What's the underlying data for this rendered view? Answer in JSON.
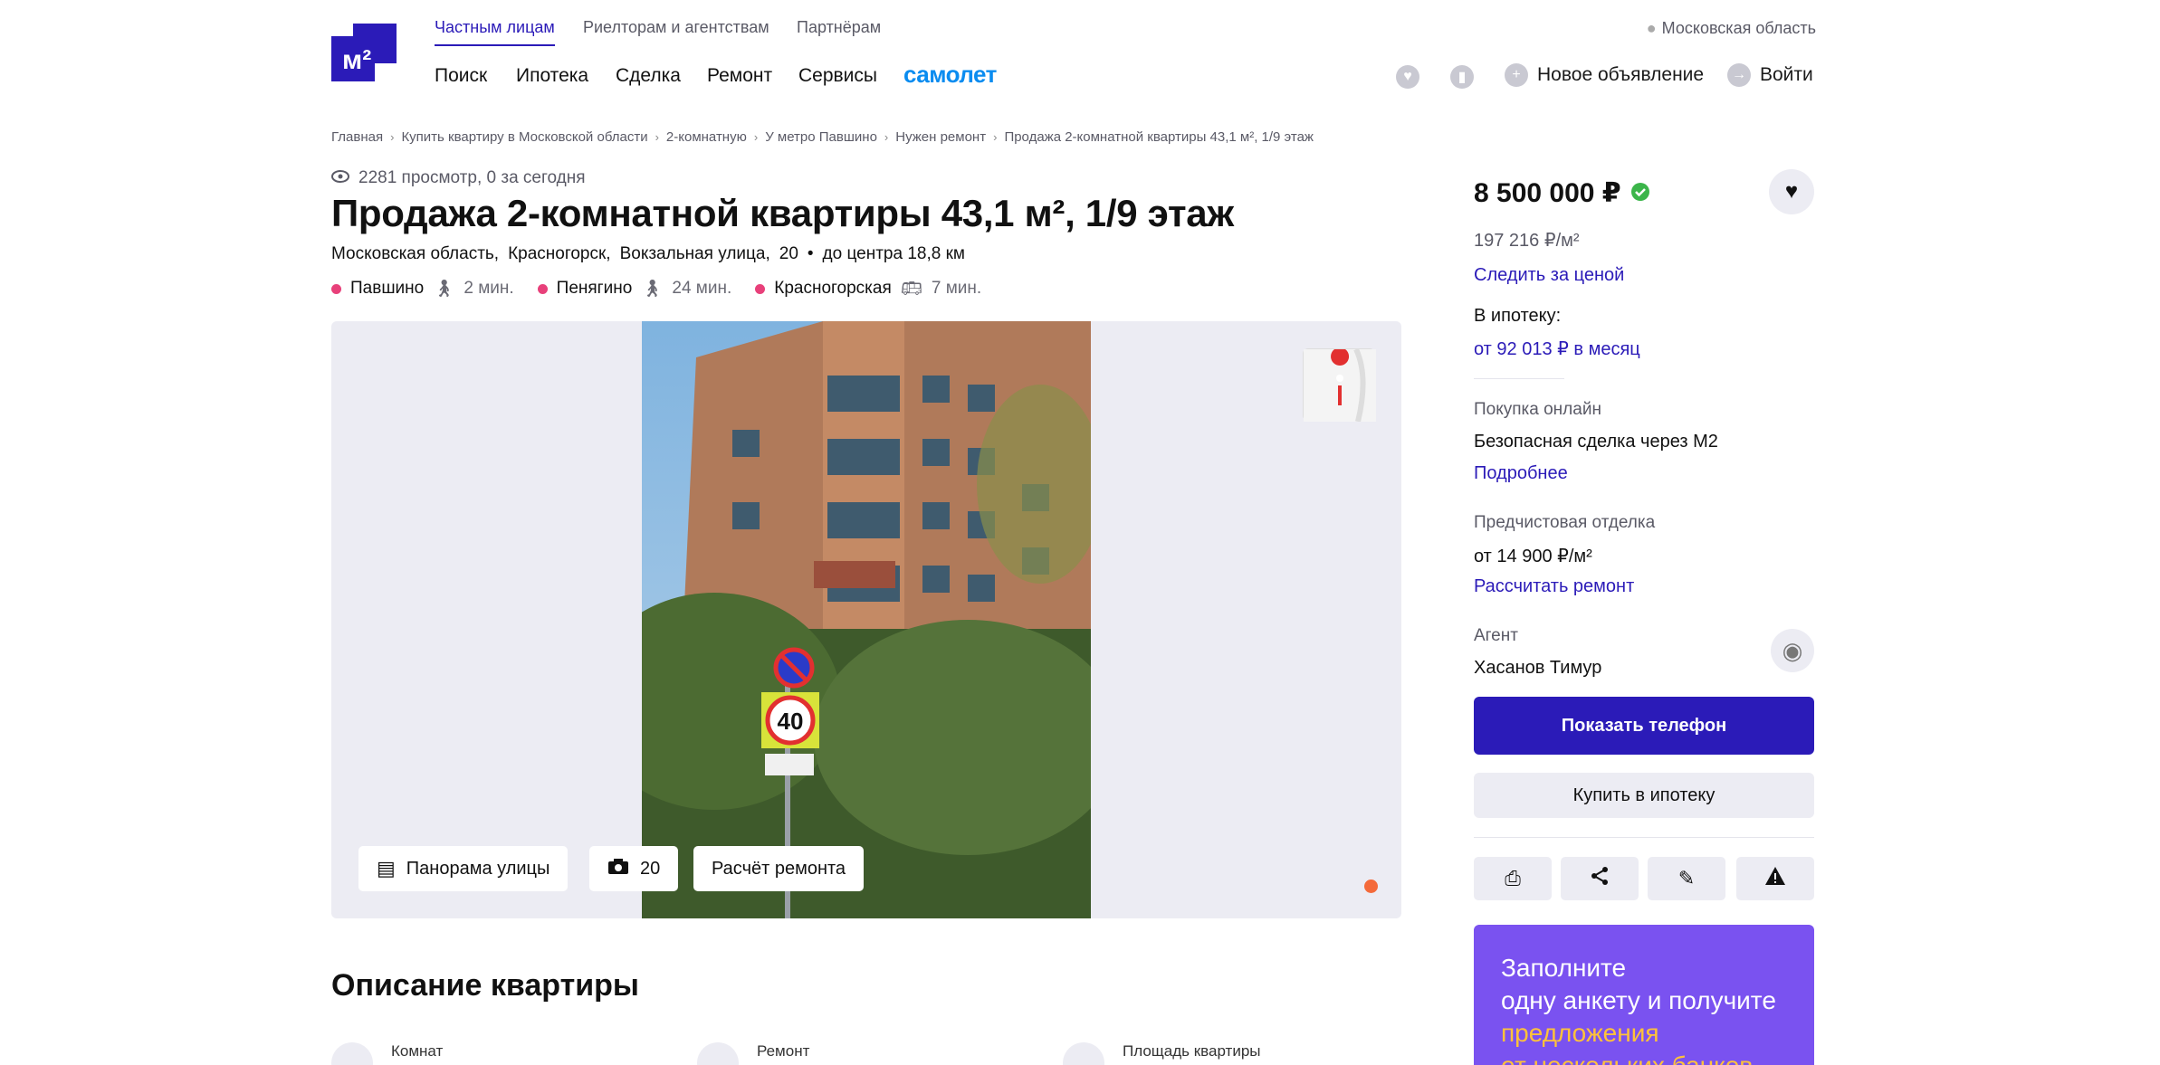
{
  "header": {
    "top_links": [
      "Частным лицам",
      "Риелторам и агентствам",
      "Партнёрам"
    ],
    "region": "Московская область",
    "nav": [
      "Поиск",
      "Ипотека",
      "Сделка",
      "Ремонт",
      "Сервисы"
    ],
    "brand": "самолет",
    "new_ad": "Новое объявление",
    "login": "Войти",
    "logo_text": "м²"
  },
  "breadcrumbs": [
    "Главная",
    "Купить квартиру в Московской области",
    "2-комнатную",
    "У метро Павшино",
    "Нужен ремонт",
    "Продажа 2-комнатной квартиры 43,1 м², 1/9 этаж"
  ],
  "listing": {
    "views": "2281 просмотр, 0 за сегодня",
    "title": "Продажа 2-комнатной квартиры 43,1 м², 1/9 этаж",
    "address": [
      "Московская область,",
      "Красногорск,",
      "Вокзальная улица,",
      "20"
    ],
    "distance": "до центра 18,8 км",
    "metro": [
      {
        "name": "Павшино",
        "time": "2 мин.",
        "mode": "walk",
        "color": "#e8407a"
      },
      {
        "name": "Пенягино",
        "time": "24 мин.",
        "mode": "walk",
        "color": "#e8407a"
      },
      {
        "name": "Красногорская",
        "time": "7 мин.",
        "mode": "bus",
        "color": "#e8407a"
      }
    ]
  },
  "gallery": {
    "panorama": "Панорама улицы",
    "photos_count": "20",
    "renovation": "Расчёт ремонта",
    "sign_number": "40"
  },
  "description": {
    "title": "Описание квартиры",
    "features": [
      "Комнат",
      "Ремонт",
      "Площадь квартиры"
    ]
  },
  "sidebar": {
    "price": "8 500 000 ₽",
    "price_per_m": "197 216 ₽/м²",
    "watch_price": "Следить за ценой",
    "mortgage_label": "В ипотеку:",
    "mortgage_value": "от 92 013 ₽ в месяц",
    "online_label": "Покупка онлайн",
    "online_value": "Безопасная сделка через М2",
    "online_link": "Подробнее",
    "finish_label": "Предчистовая отделка",
    "finish_value": "от 14 900 ₽/м²",
    "finish_link": "Рассчитать ремонт",
    "agent_label": "Агент",
    "agent_name": "Хасанов Тимур",
    "show_phone": "Показать телефон",
    "buy_mortgage": "Купить в ипотеку"
  },
  "promo": {
    "line1": "Заполните",
    "line2": "одну анкету и получите",
    "line3": "предложения",
    "line4": "от нескольких банков"
  },
  "colors": {
    "accent": "#2b1bb8",
    "brand_samolet": "#0a8cf0",
    "promo_bg": "#7a52f0",
    "metro_dot": "#e8407a",
    "verified": "#3bb54a"
  }
}
